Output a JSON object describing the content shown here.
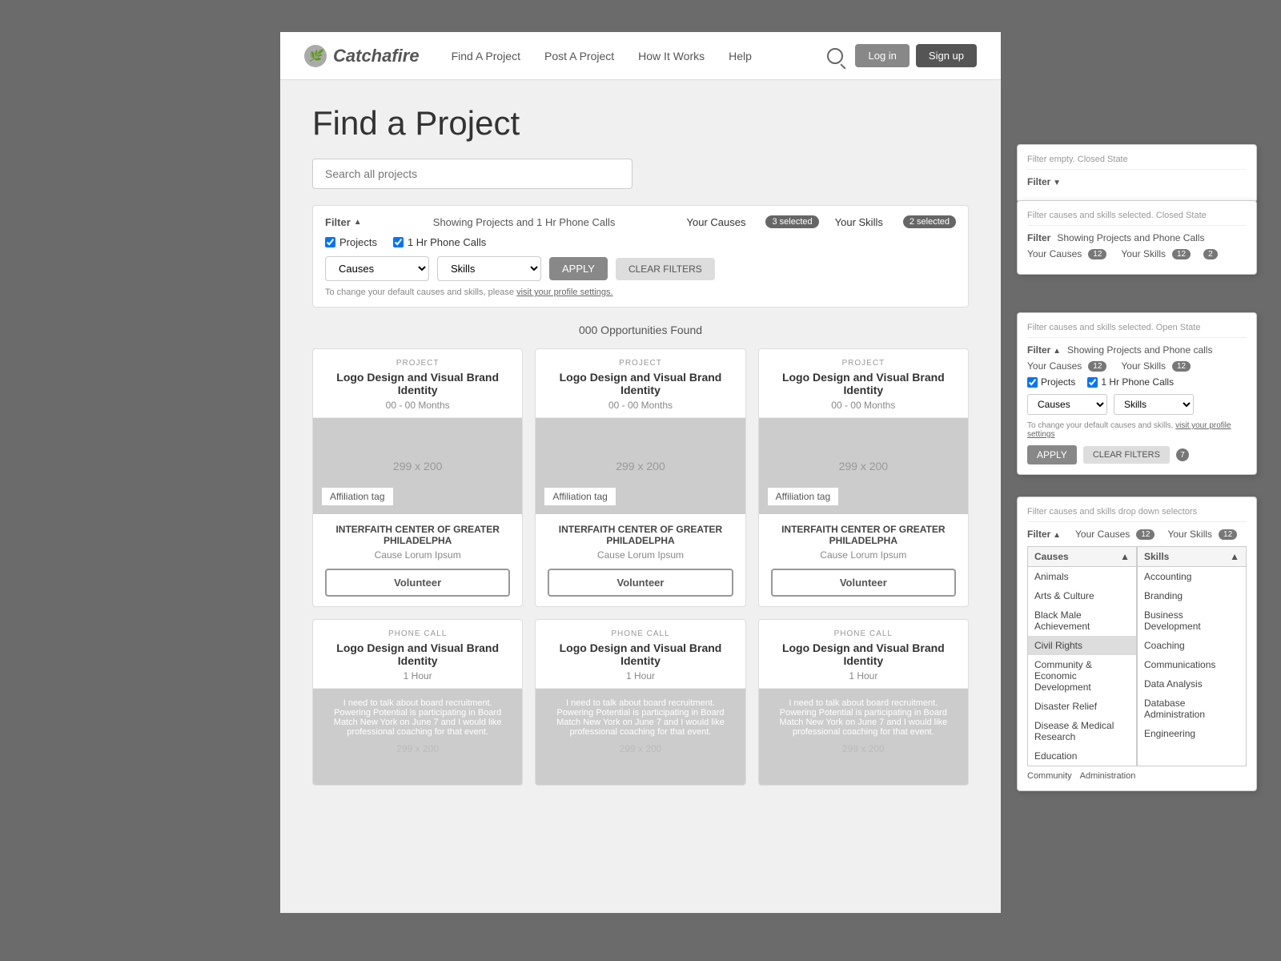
{
  "navbar": {
    "logo_text": "Catchafire",
    "links": [
      {
        "label": "Find A Project",
        "id": "find-project"
      },
      {
        "label": "Post A Project",
        "id": "post-project"
      },
      {
        "label": "How It Works",
        "id": "how-it-works"
      },
      {
        "label": "Help",
        "id": "help"
      }
    ],
    "login_label": "Log in",
    "signup_label": "Sign up"
  },
  "page": {
    "title": "Find a Project"
  },
  "search": {
    "placeholder": "Search all projects"
  },
  "filter_bar": {
    "label": "Filter",
    "showing_text": "Showing Projects and 1 Hr Phone Calls",
    "your_causes": "Your Causes",
    "your_causes_badge": "3 selected",
    "your_skills": "Your Skills",
    "your_skills_badge": "2 selected",
    "projects_label": "Projects",
    "phone_calls_label": "1 Hr Phone Calls",
    "causes_label": "Causes",
    "skills_label": "Skills",
    "apply_label": "APPLY",
    "clear_label": "CLEAR FILTERS",
    "note": "To change your default causes and skills, please",
    "note_link": "visit your profile settings."
  },
  "opportunities": {
    "count_text": "000 Opportunities Found"
  },
  "project_cards": [
    {
      "type": "PROJECT",
      "title": "Logo Design and Visual Brand Identity",
      "duration": "00 - 00 Months",
      "image_text": "299 x 200",
      "affiliation": "Affiliation tag",
      "org": "INTERFAITH CENTER OF GREATER PHILADELPHA",
      "cause": "Cause Lorum Ipsum",
      "button": "Volunteer"
    },
    {
      "type": "PROJECT",
      "title": "Logo Design and Visual Brand Identity",
      "duration": "00 - 00 Months",
      "image_text": "299 x 200",
      "affiliation": "Affiliation tag",
      "org": "INTERFAITH CENTER OF GREATER PHILADELPHA",
      "cause": "Cause Lorum Ipsum",
      "button": "Volunteer"
    },
    {
      "type": "PROJECT",
      "title": "Logo Design and Visual Brand Identity",
      "duration": "00 - 00 Months",
      "image_text": "299 x 200",
      "affiliation": "Affiliation tag",
      "org": "INTERFAITH CENTER OF GREATER PHILADELPHA",
      "cause": "Cause Lorum Ipsum",
      "button": "Volunteer"
    }
  ],
  "phone_cards": [
    {
      "type": "PHONE CALL",
      "title": "Logo Design and Visual Brand Identity",
      "duration": "1 Hour",
      "image_text": "299 x 200",
      "body_text": "I need to talk about board recruitment. Powering Potential is participating in Board Match New York on June 7 and I would like professional coaching for that event."
    },
    {
      "type": "PHONE CALL",
      "title": "Logo Design and Visual Brand Identity",
      "duration": "1 Hour",
      "image_text": "299 x 200",
      "body_text": "I need to talk about board recruitment. Powering Potential is participating in Board Match New York on June 7 and I would like professional coaching for that event."
    },
    {
      "type": "PHONE CALL",
      "title": "Logo Design and Visual Brand Identity",
      "duration": "1 Hour",
      "image_text": "299 x 200",
      "body_text": "I need to talk about board recruitment. Powering Potential is participating in Board Match New York on June 7 and I would like professional coaching for that event."
    }
  ],
  "annotations": {
    "panel1": {
      "title": "Filter empty. Closed State",
      "filter_label": "Filter"
    },
    "panel2": {
      "title": "Filter causes and skills selected. Closed State",
      "filter_label": "Filter",
      "showing": "Showing Projects and Phone Calls",
      "your_causes": "Your Causes",
      "causes_badge": "12",
      "your_skills": "Your Skills",
      "skills_badge": "12",
      "edit_badge": "2"
    },
    "panel3": {
      "title": "Filter causes and skills selected. Open State",
      "filter_label": "Filter",
      "showing": "Showing Projects and Phone calls",
      "your_causes": "Your Causes",
      "causes_badge": "12",
      "your_skills": "Your Skills",
      "skills_badge": "12",
      "projects_label": "Projects",
      "phone_calls_label": "1 Hr Phone Calls",
      "causes_dropdown": "Causes",
      "skills_dropdown": "Skills",
      "note": "To change your default causes and skills,",
      "note_link": "visit your profile settings",
      "apply_label": "APPLY",
      "clear_label": "CLEAR FILTERS",
      "clear_badge": "7"
    },
    "panel4": {
      "title": "Filter causes and skills drop down selectors",
      "filter_label": "Filter",
      "your_causes": "Your Causes",
      "causes_badge": "12",
      "your_skills": "Your Skills",
      "skills_badge": "12",
      "causes_col_header": "Causes",
      "skills_col_header": "Skills",
      "causes_items": [
        "Animals",
        "Arts & Culture",
        "Black Male Achievement",
        "Civil Rights",
        "Community & Economic Development",
        "Disaster Relief",
        "Disease & Medical Research",
        "Education"
      ],
      "skills_items": [
        "Accounting",
        "Branding",
        "Business Development",
        "Coaching",
        "Communications",
        "Data Analysis",
        "Database Administration",
        "Engineering"
      ],
      "selected_cause": "Civil Rights",
      "community_label": "Community",
      "administration_label": "Administration"
    }
  }
}
